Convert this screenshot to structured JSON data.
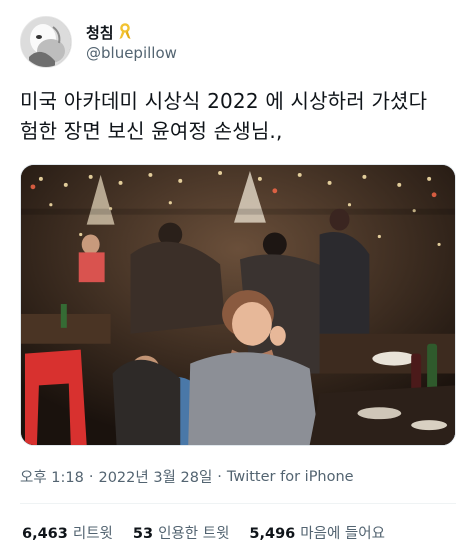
{
  "tweet": {
    "author": {
      "display_name": "청침",
      "handle": "@bluepillow",
      "badge_icon": "yellow-ribbon-icon"
    },
    "text": "미국 아카데미 시상식 2022 에 시상하러 가셨다 험한 장면 보신 윤여정 손생님.,",
    "meta": {
      "time": "오후 1:18",
      "separator": "·",
      "date": "2022년 3월 28일",
      "source": "Twitter for iPhone"
    },
    "stats": [
      {
        "count": "6,463",
        "label": "리트윗"
      },
      {
        "count": "53",
        "label": "인용한 트윗"
      },
      {
        "count": "5,496",
        "label": "마음에 들어요"
      }
    ]
  },
  "colors": {
    "text_primary": "#0f1419",
    "text_secondary": "#536471",
    "ribbon": "#f2c230",
    "divider": "#eff3f4"
  }
}
